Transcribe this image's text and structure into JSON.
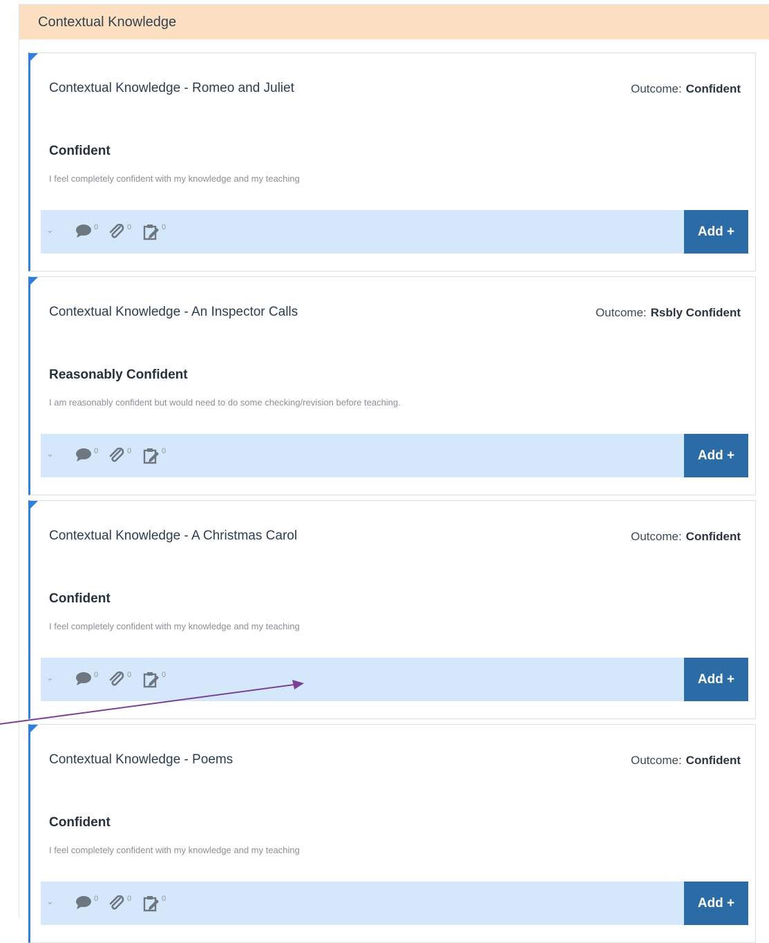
{
  "section": {
    "title": "Contextual Knowledge"
  },
  "colors": {
    "header_bg": "#fde0c2",
    "accent": "#2f7fe0",
    "action_bar": "#d4e7fb",
    "button": "#2c6ca6",
    "annotation_arrow": "#7b3f96"
  },
  "cards": [
    {
      "title": "Contextual Knowledge - Romeo and Juliet",
      "outcome_label": "Outcome:",
      "outcome_value": "Confident",
      "level": "Confident",
      "description": "I feel completely confident with my knowledge and my teaching",
      "comments": "0",
      "attachments": "0",
      "notes": "0",
      "add_label": "Add +"
    },
    {
      "title": "Contextual Knowledge - An Inspector Calls",
      "outcome_label": "Outcome:",
      "outcome_value": "Rsbly Confident",
      "level": "Reasonably Confident",
      "description": "I am reasonably confident but would need to do some checking/revision before teaching.",
      "comments": "0",
      "attachments": "0",
      "notes": "0",
      "add_label": "Add +"
    },
    {
      "title": "Contextual Knowledge - A Christmas Carol",
      "outcome_label": "Outcome:",
      "outcome_value": "Confident",
      "level": "Confident",
      "description": "I feel completely confident with my knowledge and my teaching",
      "comments": "0",
      "attachments": "0",
      "notes": "0",
      "add_label": "Add +"
    },
    {
      "title": "Contextual Knowledge - Poems",
      "outcome_label": "Outcome:",
      "outcome_value": "Confident",
      "level": "Confident",
      "description": "I feel completely confident with my knowledge and my teaching",
      "comments": "0",
      "attachments": "0",
      "notes": "0",
      "add_label": "Add +"
    }
  ]
}
